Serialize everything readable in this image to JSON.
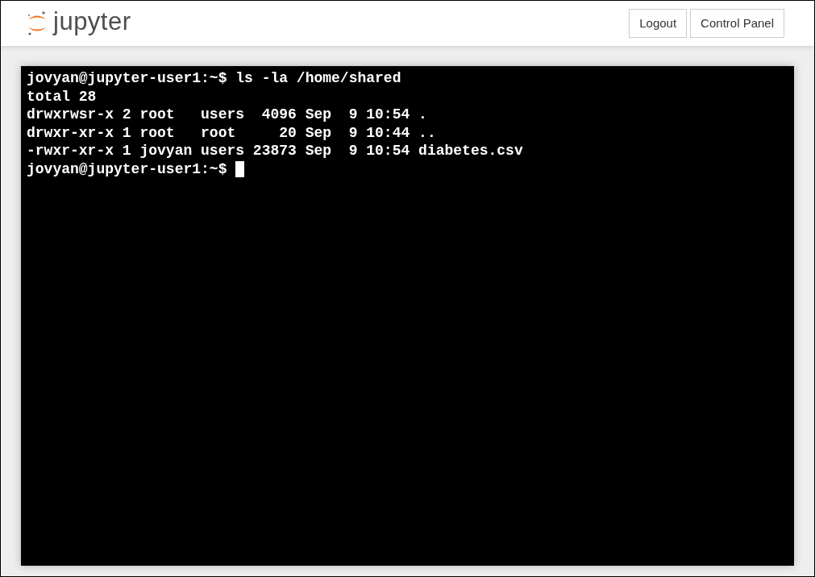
{
  "header": {
    "logo_text": "jupyter",
    "buttons": [
      "Logout",
      "Control Panel"
    ]
  },
  "terminal": {
    "lines": [
      "jovyan@jupyter-user1:~$ ls -la /home/shared",
      "total 28",
      "drwxrwsr-x 2 root   users  4096 Sep  9 10:54 .",
      "drwxr-xr-x 1 root   root     20 Sep  9 10:44 ..",
      "-rwxr-xr-x 1 jovyan users 23873 Sep  9 10:54 diabetes.csv"
    ],
    "prompt": "jovyan@jupyter-user1:~$"
  }
}
